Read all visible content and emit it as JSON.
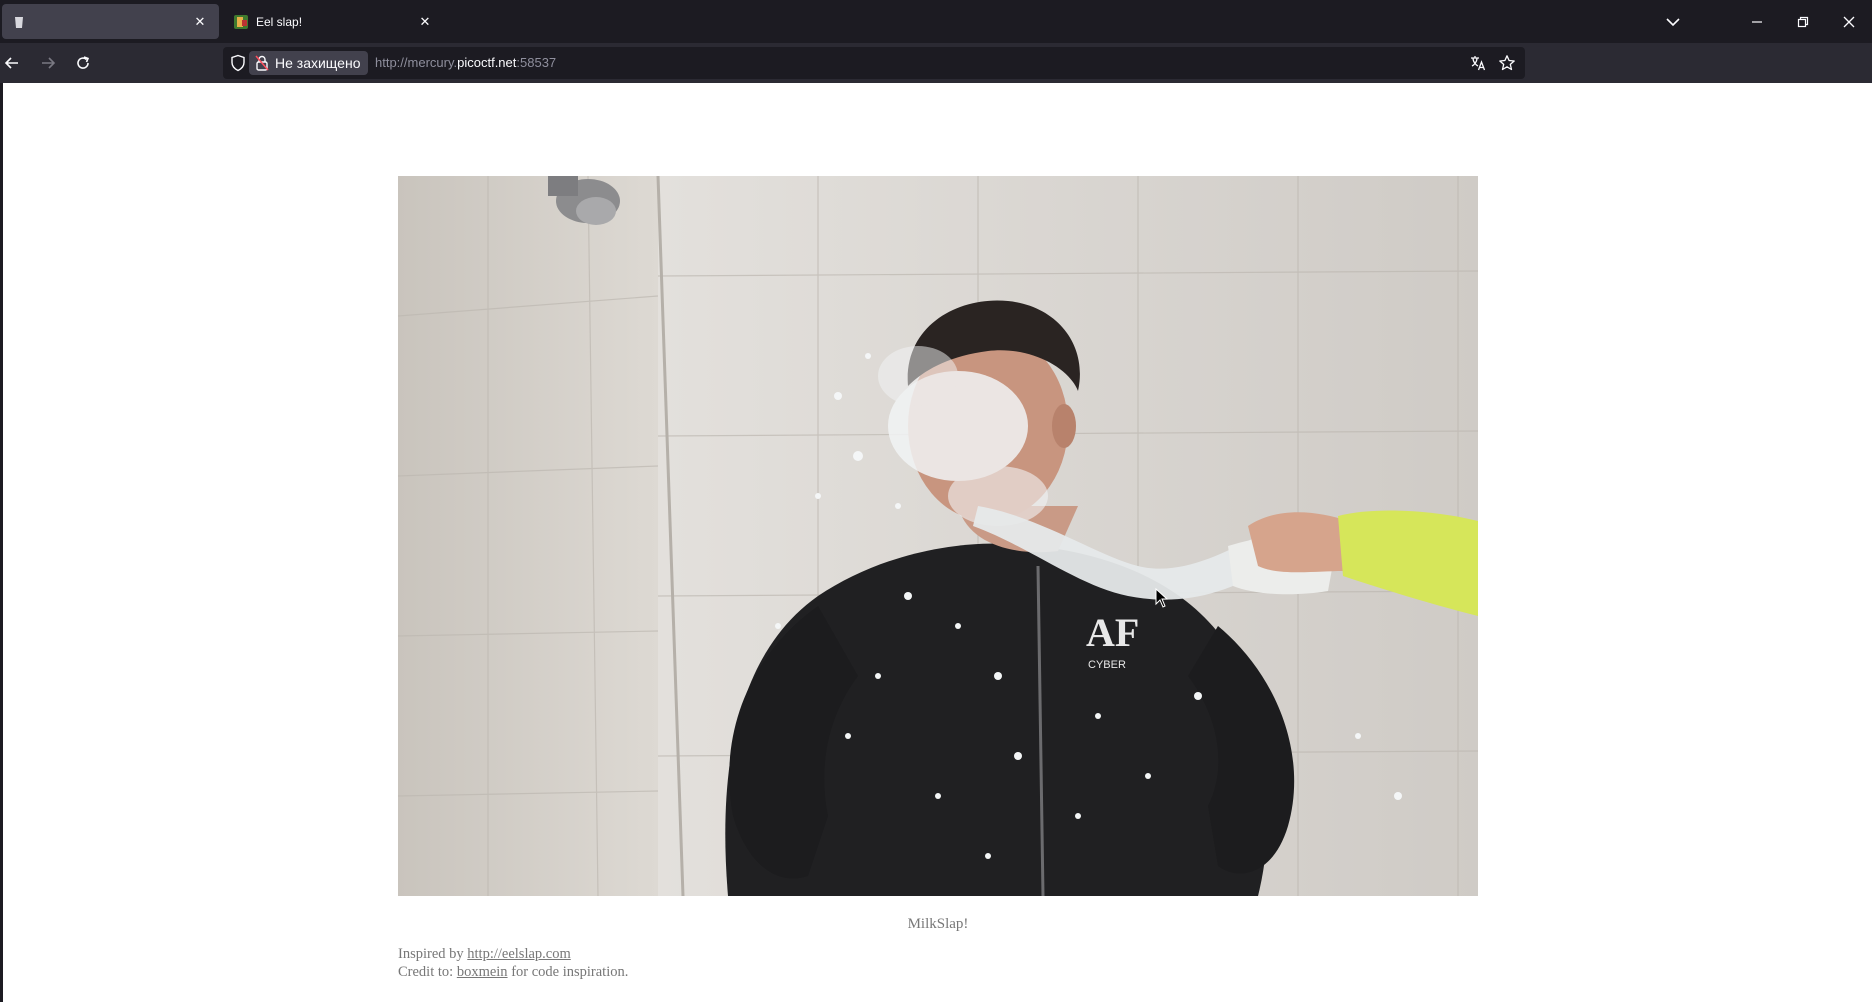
{
  "tabs": [
    {
      "title": "",
      "active": true,
      "favicon": "trash-icon"
    },
    {
      "title": "Eel slap!",
      "active": false,
      "favicon": "site-favicon-icon"
    }
  ],
  "window_controls": [
    "tab-list-icon",
    "minimize-icon",
    "restore-icon",
    "close-icon"
  ],
  "toolbar": {
    "back": "back-arrow-icon",
    "forward": "forward-arrow-icon",
    "reload": "reload-icon"
  },
  "urlbar": {
    "security_label": "Не захищено",
    "url_prefix": "http://mercury.",
    "url_host": "picoctf.net",
    "url_suffix": ":58537",
    "icons": [
      "translate-icon",
      "bookmark-star-icon"
    ]
  },
  "page": {
    "video_alt": "MilkSlap!",
    "caption": "MilkSlap!",
    "footer": {
      "inspired_prefix": "Inspired by ",
      "inspired_link": "http://eelslap.com",
      "credit_prefix": "Credit to: ",
      "credit_link": "boxmein",
      "credit_suffix": " for code inspiration."
    }
  },
  "colors": {
    "chrome_dark": "#1c1b22",
    "toolbar": "#2b2a33",
    "active_tab": "#42414d",
    "page_bg": "#ffffff",
    "footer_text": "#777777"
  }
}
